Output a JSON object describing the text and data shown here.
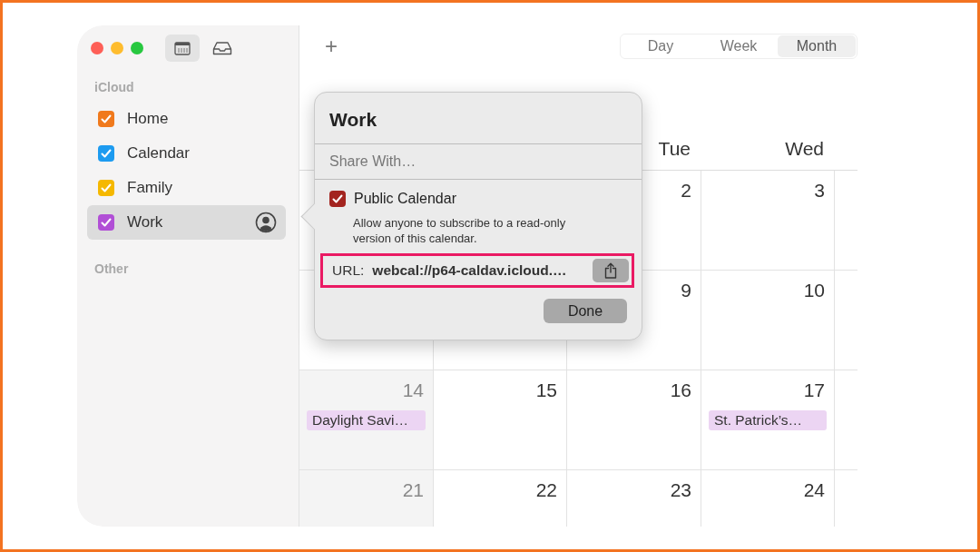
{
  "toolbar_buttons": [
    {
      "kind": "calendars",
      "selected": true
    },
    {
      "kind": "inbox",
      "selected": false
    }
  ],
  "sidebar": {
    "sections": [
      {
        "title": "iCloud",
        "items": [
          {
            "name": "Home",
            "color": "#f0791c",
            "checked": true,
            "selected": false,
            "shared": false
          },
          {
            "name": "Calendar",
            "color": "#1d9bf0",
            "checked": true,
            "selected": false,
            "shared": false
          },
          {
            "name": "Family",
            "color": "#f5b800",
            "checked": true,
            "selected": false,
            "shared": false
          },
          {
            "name": "Work",
            "color": "#b14fd6",
            "checked": true,
            "selected": true,
            "shared": true
          }
        ]
      },
      {
        "title": "Other"
      }
    ]
  },
  "add_button": "+",
  "views": [
    {
      "label": "Day",
      "selected": false
    },
    {
      "label": "Week",
      "selected": false
    },
    {
      "label": "Month",
      "selected": true
    }
  ],
  "calendar": {
    "weekday_headers": [
      {
        "kind": "tue",
        "label": "Tue"
      },
      {
        "kind": "wed",
        "label": "Wed"
      }
    ],
    "weeks": [
      {
        "days": [
          {
            "kind": "tue",
            "number": "2",
            "weekend": false
          },
          {
            "kind": "wed",
            "number": "3",
            "weekend": false
          }
        ]
      },
      {
        "days": [
          {
            "kind": "tue",
            "number": "9",
            "weekend": false
          },
          {
            "kind": "wed",
            "number": "10",
            "weekend": false
          }
        ]
      },
      {
        "days": [
          {
            "kind": "sun",
            "number": "14",
            "weekend": true,
            "events": [
              "Daylight Savi…"
            ]
          },
          {
            "kind": "mon",
            "number": "15",
            "weekend": false
          },
          {
            "kind": "tue",
            "number": "16",
            "weekend": false
          },
          {
            "kind": "wed",
            "number": "17",
            "weekend": false,
            "events": [
              "St. Patrick’s…"
            ]
          }
        ]
      },
      {
        "days": [
          {
            "kind": "sun",
            "number": "21",
            "weekend": true
          },
          {
            "kind": "mon",
            "number": "22",
            "weekend": false
          },
          {
            "kind": "tue",
            "number": "23",
            "weekend": false
          },
          {
            "kind": "wed",
            "number": "24",
            "weekend": false
          }
        ]
      }
    ]
  },
  "popover": {
    "title": "Work",
    "share_field": {
      "placeholder": "Share With…"
    },
    "public_calendar": {
      "label": "Public Calendar",
      "checked": true
    },
    "description": "Allow anyone to subscribe to a read-only version of this calendar.",
    "url_label": "URL:",
    "url": "webcal://p64-caldav.icloud.…",
    "highlighted": true,
    "done_button": "Done"
  }
}
